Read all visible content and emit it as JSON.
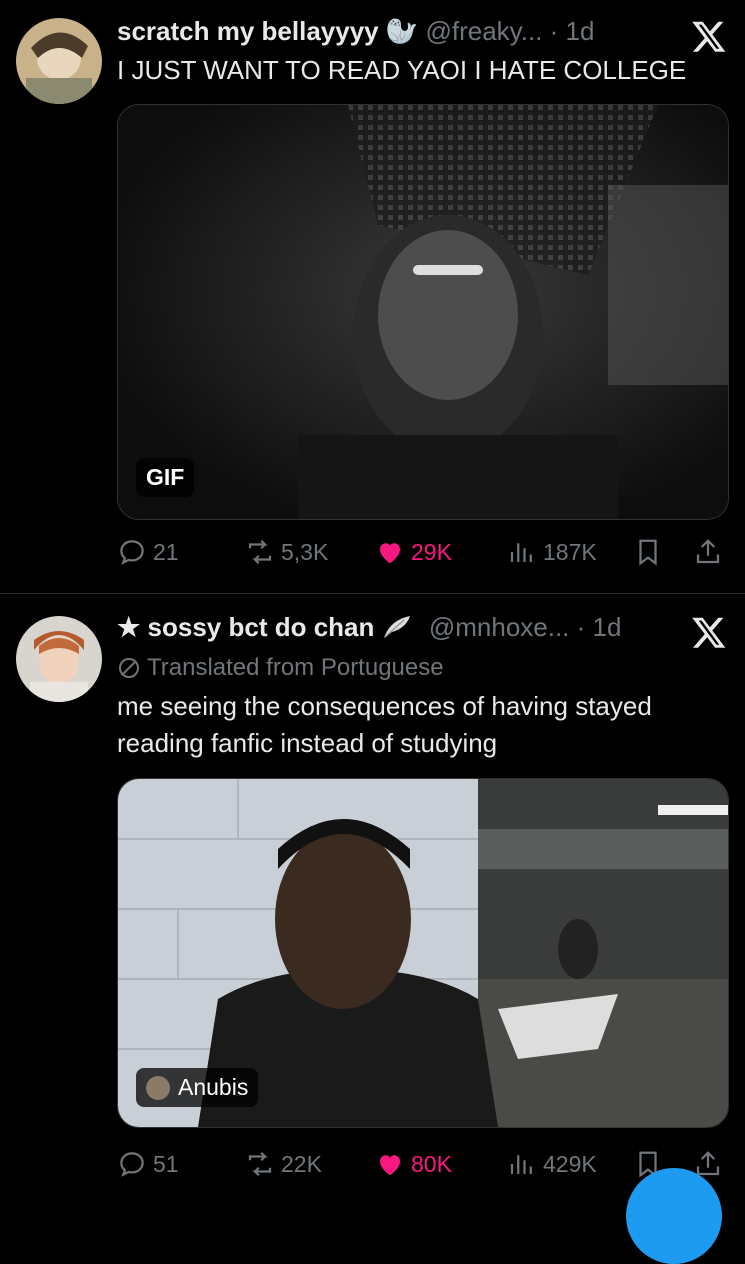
{
  "tweets": [
    {
      "display_name": "scratch my bellayyyy",
      "emoji": "🦭",
      "handle": "@freaky...",
      "time": "1d",
      "text": "I JUST WANT TO READ YAOI I HATE COLLEGE",
      "media_badge": "GIF",
      "stats": {
        "replies": "21",
        "reposts": "5,3K",
        "likes": "29K",
        "views": "187K"
      }
    },
    {
      "display_name": "★ sossy bct do chan",
      "handle": "@mnhoxe...",
      "time": "1d",
      "translated": "Translated from Portuguese",
      "text": "me seeing the consequences of having stayed reading fanfic instead of studying",
      "media_badge": "Anubis",
      "stats": {
        "replies": "51",
        "reposts": "22K",
        "likes": "80K",
        "views": "429K"
      }
    }
  ],
  "colors": {
    "like": "#f91880",
    "muted": "#71767b",
    "text": "#e7e9ea",
    "divider": "#2f3336"
  },
  "icons": [
    "x-logo-icon",
    "reply-icon",
    "repost-icon",
    "heart-icon",
    "views-icon",
    "bookmark-icon",
    "share-icon",
    "feather-icon",
    "globe-icon",
    "seal-emoji"
  ]
}
